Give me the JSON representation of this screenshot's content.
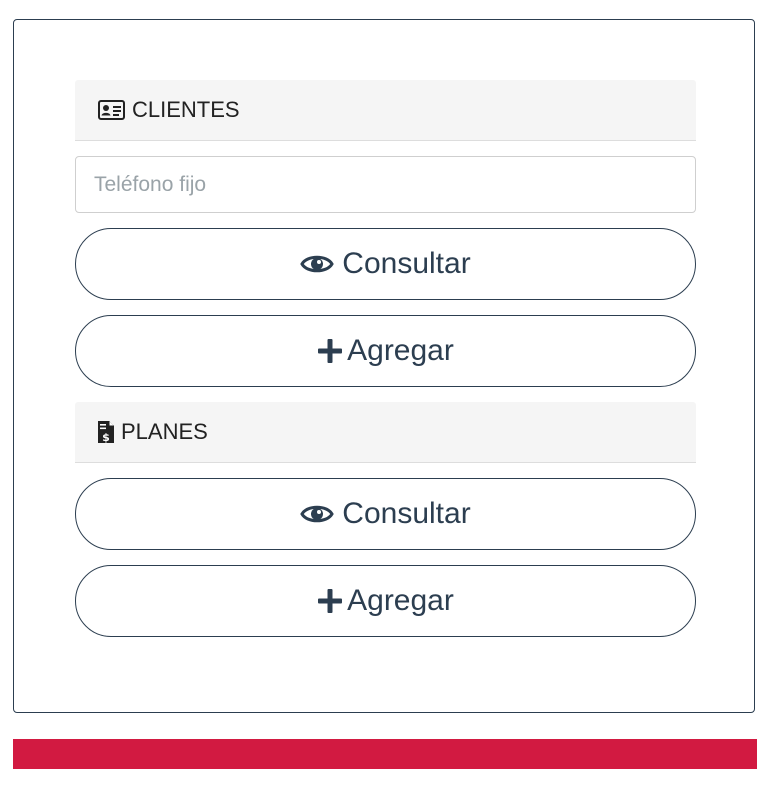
{
  "clientes": {
    "header": "CLIENTES",
    "header_icon": "id-card-icon",
    "phone_placeholder": "Teléfono fijo",
    "phone_value": "",
    "consultar_label": "Consultar",
    "consultar_icon": "eye-icon",
    "agregar_label": "Agregar",
    "agregar_icon": "plus-icon"
  },
  "planes": {
    "header": "PLANES",
    "header_icon": "file-invoice-dollar-icon",
    "consultar_label": "Consultar",
    "consultar_icon": "eye-icon",
    "agregar_label": "Agregar",
    "agregar_icon": "plus-icon"
  },
  "colors": {
    "primary": "#2c3e50",
    "footer": "#d21a41",
    "header_bg": "#f5f5f5"
  }
}
